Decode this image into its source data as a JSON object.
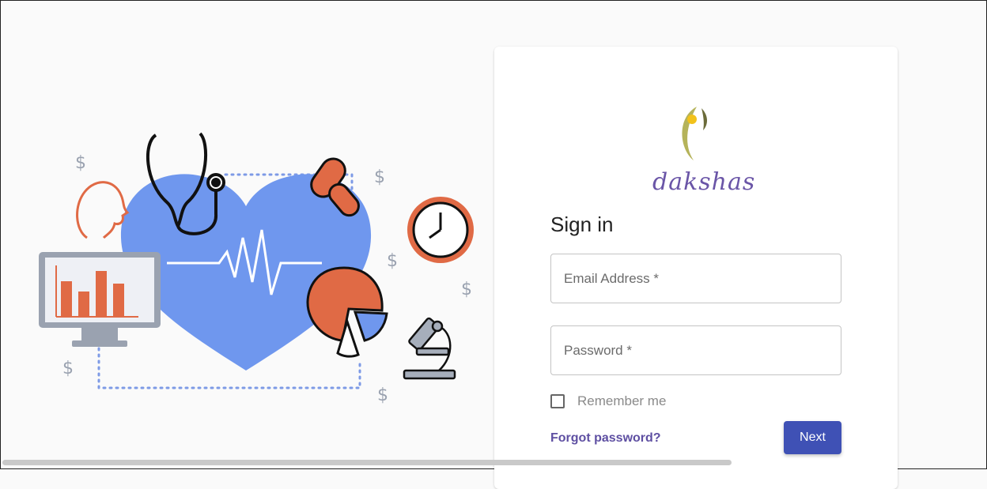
{
  "brand": {
    "name": "dakshas",
    "colors": {
      "leaf": "#b5b35a",
      "dot": "#f2c21b",
      "text": "#6a55a7"
    }
  },
  "login": {
    "title": "Sign in",
    "email_placeholder": "Email Address *",
    "password_placeholder": "Password *",
    "remember_label": "Remember me",
    "forgot_label": "Forgot password?",
    "next_label": "Next"
  },
  "illustration": {
    "icons": [
      "heart-icon",
      "stethoscope-icon",
      "head-icon",
      "monitor-chart-icon",
      "pills-icon",
      "clock-icon",
      "pie-chart-icon",
      "microscope-icon",
      "dollar-icon"
    ],
    "colors": {
      "heart": "#6f97ee",
      "accent": "#e06a45",
      "dots": "#7d9ae6"
    }
  }
}
